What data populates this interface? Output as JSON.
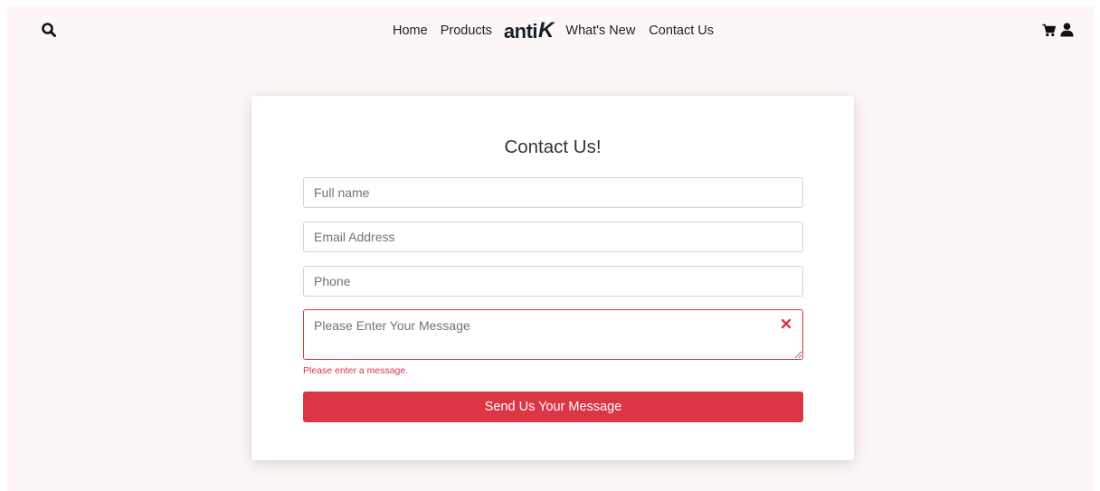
{
  "header": {
    "search_icon": "search-icon",
    "nav": {
      "home": "Home",
      "products": "Products",
      "logo_anti": "anti",
      "logo_k": "K",
      "whats_new": "What's New",
      "contact_us": "Contact Us"
    },
    "cart_icon": "cart-icon",
    "user_icon": "user-icon"
  },
  "form": {
    "title": "Contact Us!",
    "full_name": {
      "placeholder": "Full name",
      "value": ""
    },
    "email": {
      "placeholder": "Email Address",
      "value": ""
    },
    "phone": {
      "placeholder": "Phone",
      "value": ""
    },
    "message": {
      "placeholder": "Please Enter Your Message",
      "value": ""
    },
    "message_error": "Please enter a message.",
    "submit_label": "Send Us Your Message"
  },
  "colors": {
    "page_background": "#fcf7f6",
    "accent": "#dc3545",
    "text": "#222222"
  }
}
